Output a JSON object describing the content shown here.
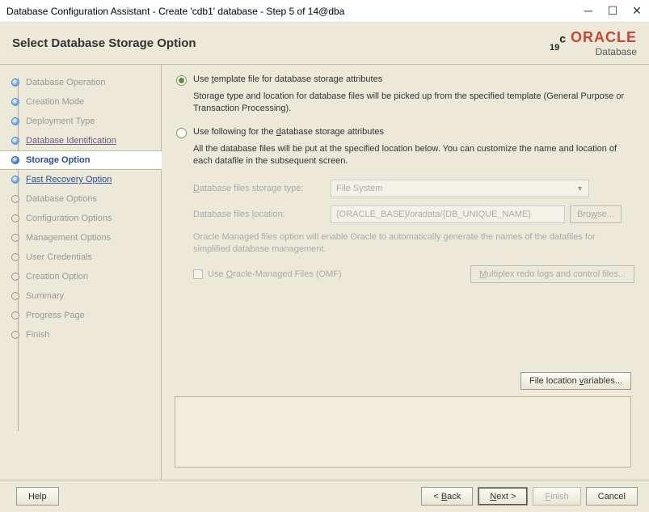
{
  "window": {
    "title": "Database Configuration Assistant - Create 'cdb1' database - Step 5 of 14@dba"
  },
  "header": {
    "title": "Select Database Storage Option",
    "logo_version": "19",
    "logo_sup": "c",
    "logo_brand": "ORACLE",
    "logo_product": "Database"
  },
  "sidebar": {
    "steps": [
      "Database Operation",
      "Creation Mode",
      "Deployment Type",
      "Database Identification",
      "Storage Option",
      "Fast Recovery Option",
      "Database Options",
      "Configuration Options",
      "Management Options",
      "User Credentials",
      "Creation Option",
      "Summary",
      "Progress Page",
      "Finish"
    ]
  },
  "content": {
    "opt1_label": "Use template file for database storage attributes",
    "opt1_desc": "Storage type and location for database files will be picked up from the specified template (General Purpose or Transaction Processing).",
    "opt2_label": "Use following for the database storage attributes",
    "opt2_desc": "All the database files will be put at the specified location below. You can customize the name and location of each datafile in the subsequent screen.",
    "storage_type_label": "Database files storage type:",
    "storage_type_value": "File System",
    "location_label": "Database files location:",
    "location_value": "{ORACLE_BASE}/oradata/{DB_UNIQUE_NAME}",
    "browse_label": "Browse...",
    "omf_note": "Oracle Managed files option will enable Oracle to automatically generate the names of the datafiles for simplified database management.",
    "omf_label": "Use Oracle-Managed Files (OMF)",
    "multiplex_label": "Multiplex redo logs and control files...",
    "file_loc_vars": "File location variables..."
  },
  "footer": {
    "help": "Help",
    "back": "< Back",
    "next": "Next >",
    "finish": "Finish",
    "cancel": "Cancel"
  }
}
